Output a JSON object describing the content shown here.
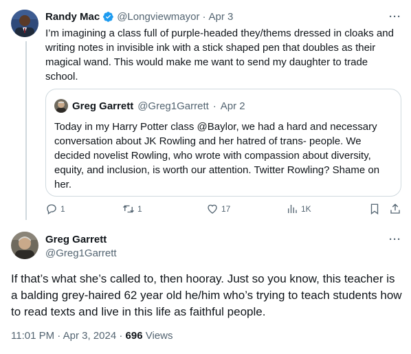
{
  "tweet1": {
    "author_name": "Randy Mac",
    "handle": "@Longviewmayor",
    "separator": "·",
    "date": "Apr 3",
    "body": "I’m imagining a class full of purple-headed they/thems dressed in cloaks and writing notes in invisible ink with a stick shaped pen that doubles as their magical wand.  This would make me want to send my daughter to trade school.",
    "more_label": "···"
  },
  "quote": {
    "author_name": "Greg Garrett",
    "handle": "@Greg1Garrett",
    "separator": "·",
    "date": "Apr 2",
    "body": "Today in my Harry Potter class @Baylor, we had a hard and necessary conversation about JK Rowling and her hatred of trans- people. We decided novelist Rowling, who wrote with compassion about diversity, equity, and inclusion, is worth our attention. Twitter Rowling? Shame on her."
  },
  "actions": {
    "reply_count": "1",
    "retweet_count": "1",
    "like_count": "17",
    "views_count": "1K"
  },
  "tweet2": {
    "author_name": "Greg Garrett",
    "handle": "@Greg1Garrett",
    "more_label": "···",
    "body": "If that’s what she’s called to, then hooray. Just so you know, this teacher is a balding grey-haired 62 year old he/him who’s trying to teach students how to read texts and live in this life as faithful people.",
    "time": "11:01 PM",
    "separator1": "·",
    "date": "Apr 3, 2024",
    "separator2": "·",
    "views_count": "696",
    "views_label": "Views"
  },
  "icons": {
    "verified": "verified-badge-icon",
    "reply": "reply-icon",
    "retweet": "retweet-icon",
    "like": "heart-icon",
    "views": "views-chart-icon",
    "bookmark": "bookmark-icon",
    "share": "share-icon",
    "more": "more-icon"
  },
  "colors": {
    "text": "#0f1419",
    "muted": "#536471",
    "border": "#cfd9de",
    "verified": "#1d9bf0"
  }
}
